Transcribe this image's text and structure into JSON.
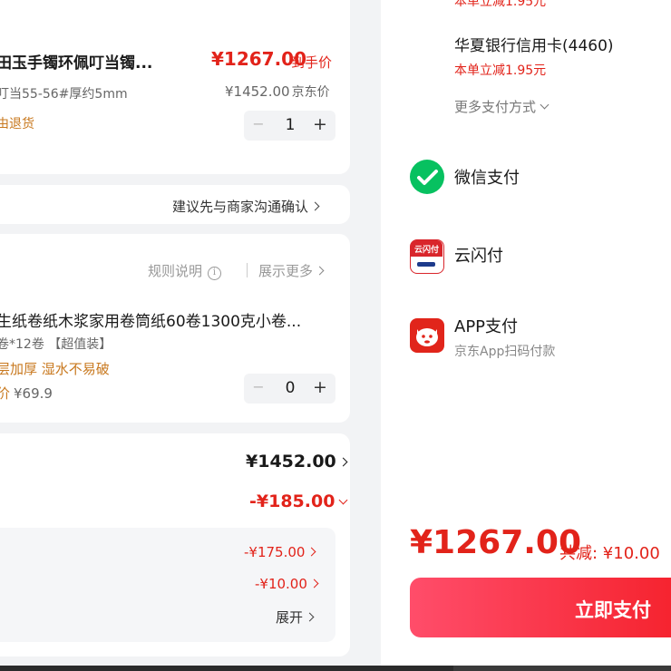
{
  "product1": {
    "title": "田玉手镯环佩叮当镯...",
    "spec": "叮当55-56#厚约5mm",
    "service": "由退货",
    "price": "¥1267.00",
    "price_tag": "到手价",
    "jd_price": "¥1452.00",
    "jd_price_tag": "京东价",
    "qty": "1",
    "minus": "−",
    "plus": "+"
  },
  "notice": {
    "text": "建议先与商家沟通确认"
  },
  "product2": {
    "rules_label": "规则说明",
    "info_glyph": "i",
    "more_label": "展示更多",
    "title": "生纸卷纸木浆家用卷筒纸60卷1300克小卷...",
    "spec": "卷*12卷 【超值装】",
    "feature": "层加厚 湿水不易破",
    "price_prefix": "价",
    "price": "¥69.9",
    "qty": "0",
    "minus": "−",
    "plus": "+"
  },
  "summary": {
    "total": "¥1452.00",
    "discount": "-¥185.00",
    "discount_items": [
      "-¥175.00",
      "-¥10.00"
    ],
    "expand_label": "展开"
  },
  "payment": {
    "top_partial_text": "本单立减1.95元",
    "bank_card": "华夏银行信用卡(4460)",
    "bank_discount": "本单立减1.95元",
    "more_methods": "更多支付方式",
    "wechat": "微信支付",
    "unionpay": "云闪付",
    "unionpay_logo": "云闪付",
    "app_pay": "APP支付",
    "app_pay_sub": "京东App扫码付款"
  },
  "footer": {
    "total": "¥1267.00",
    "saved": "共减: ¥10.00",
    "pay_button": "立即支付"
  },
  "colors": {
    "accent_red": "#e2231a",
    "gold": "#c8781e",
    "wechat_green": "#07c160",
    "pay_gradient_start": "#ff4d6a",
    "pay_gradient_end": "#f5222d"
  }
}
